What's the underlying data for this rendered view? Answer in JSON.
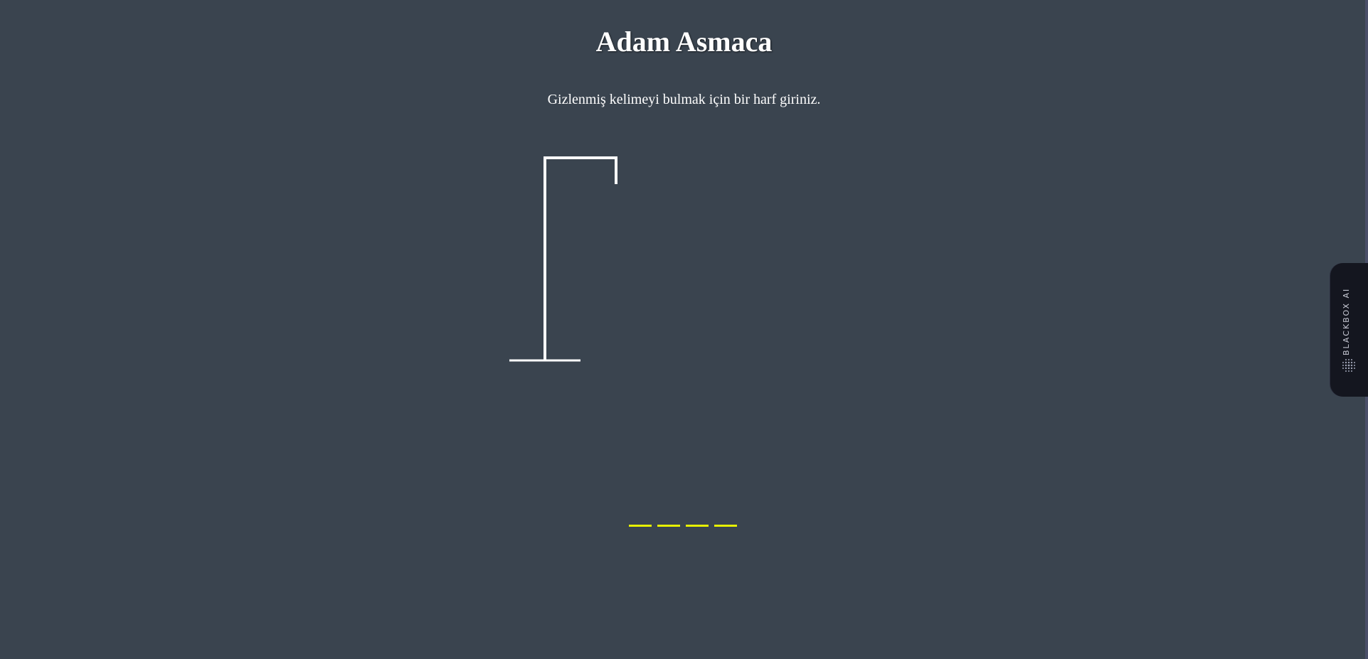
{
  "header": {
    "title": "Adam Asmaca",
    "instruction": "Gizlenmiş kelimeyi bulmak için bir harf giriniz."
  },
  "game": {
    "word_slots": [
      "",
      "",
      "",
      ""
    ],
    "word_color": "#e6f000",
    "drawing_color": "#ffffff"
  },
  "sidebar_tab": {
    "label": "BLACKBOX AI",
    "icon": "dot-grid-icon"
  }
}
